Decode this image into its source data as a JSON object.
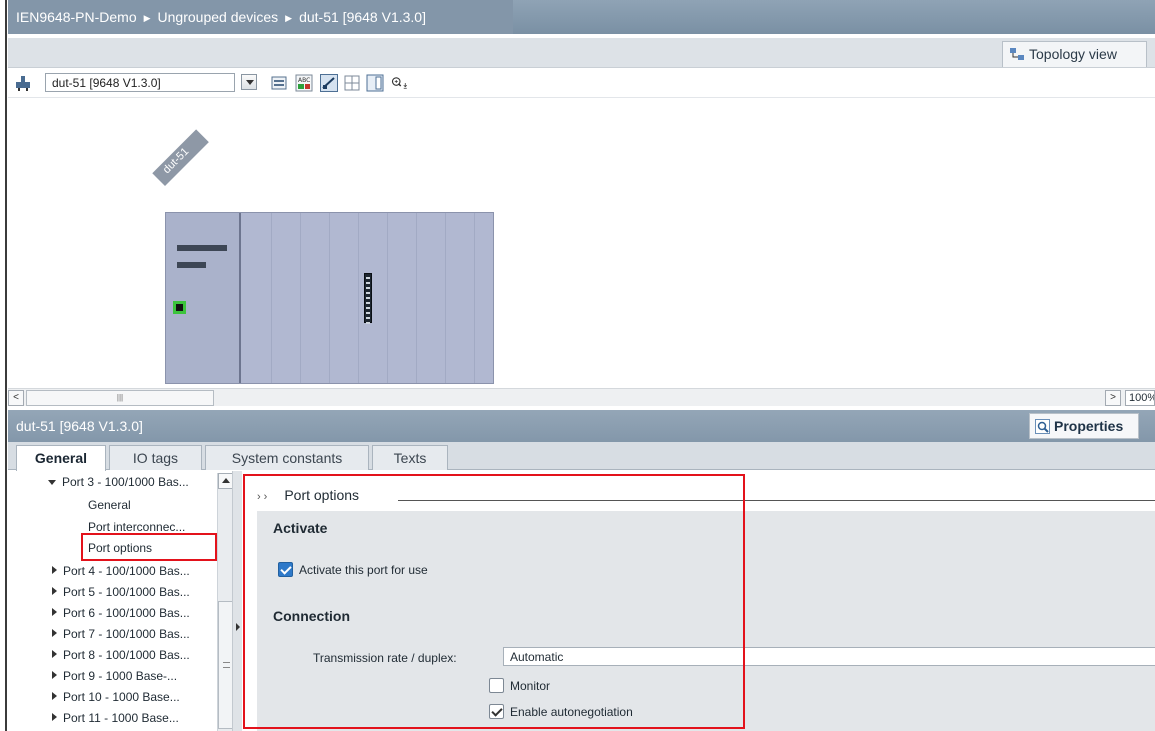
{
  "breadcrumb": {
    "items": [
      "IEN9648-PN-Demo",
      "Ungrouped devices",
      "dut-51 [9648 V1.3.0]"
    ]
  },
  "view_tabs": {
    "topology": "Topology view"
  },
  "toolbar": {
    "device_select_value": "dut-51 [9648 V1.3.0]",
    "icons": [
      "network-device-icon",
      "card-view-icon",
      "io-text-icon",
      "edit-wire-icon",
      "grid-icon",
      "table-icon",
      "zoom-in-icon"
    ]
  },
  "canvas": {
    "device_label": "dut-51",
    "port_color": "#3cc43c"
  },
  "hscroll": {
    "zoom": "100%"
  },
  "properties": {
    "title": "dut-51 [9648 V1.3.0]",
    "button_label": "Properties"
  },
  "tabs": [
    {
      "label": "General",
      "active": true
    },
    {
      "label": "IO tags",
      "active": false
    },
    {
      "label": "System constants",
      "active": false
    },
    {
      "label": "Texts",
      "active": false
    }
  ],
  "tree": {
    "expanded": "Port 3 - 100/1000 Bas...",
    "children": [
      "General",
      "Port interconnec...",
      "Port options"
    ],
    "collapsed": [
      "Port 4 - 100/1000 Bas...",
      "Port 5 - 100/1000 Bas...",
      "Port 6 - 100/1000 Bas...",
      "Port 7 - 100/1000 Bas...",
      "Port 8 - 100/1000 Bas...",
      "Port 9 - 1000 Base-...",
      "Port 10 - 1000 Base...",
      "Port 11 - 1000 Base..."
    ],
    "selected": "Port options"
  },
  "content": {
    "section_title": "Port options",
    "activate": {
      "title": "Activate",
      "checkbox_label": "Activate this port for use",
      "checked": true
    },
    "connection": {
      "title": "Connection",
      "rate_label": "Transmission rate / duplex:",
      "rate_value": "Automatic",
      "monitor_label": "Monitor",
      "monitor_checked": false,
      "autoneg_label": "Enable autonegotiation",
      "autoneg_checked": true
    }
  },
  "colors": {
    "highlight_box": "#e3121b",
    "header_bg": "#8396a9",
    "checkbox_checked": "#2e79c9"
  }
}
